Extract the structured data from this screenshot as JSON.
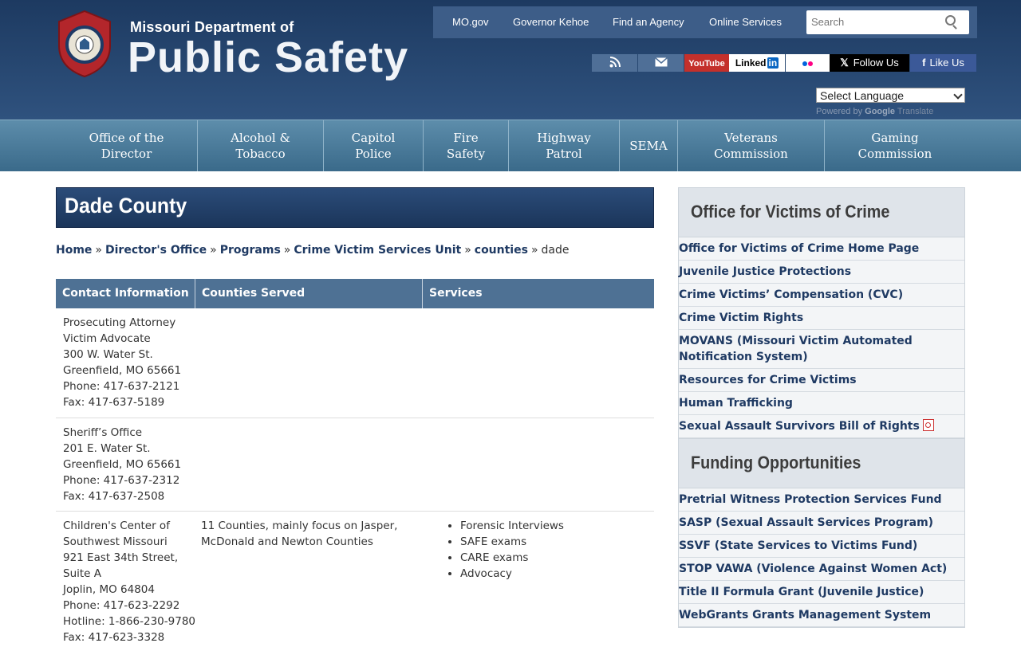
{
  "header": {
    "logo_line1": "Missouri Department of",
    "logo_line2": "Public Safety",
    "seal_text": "MISSOURI DEPARTMENT OF PUBLIC SAFETY",
    "top_links": [
      "MO.gov",
      "Governor Kehoe",
      "Find an Agency",
      "Online Services"
    ],
    "search_placeholder": "Search",
    "social": {
      "youtube": "YouTube",
      "linkedin": "Linked",
      "linkedin_in": "in",
      "x_follow": "Follow Us",
      "facebook_like": "Like Us"
    },
    "language_select": "Select Language",
    "powered_by": "Powered by",
    "google": "Google",
    "translate": "Translate"
  },
  "nav": [
    {
      "line1": "Office of the",
      "line2": "Director"
    },
    {
      "line1": "Alcohol &",
      "line2": "Tobacco"
    },
    {
      "line1": "Capitol",
      "line2": "Police"
    },
    {
      "line1": "Fire",
      "line2": "Safety"
    },
    {
      "line1": "Highway",
      "line2": "Patrol"
    },
    {
      "line1": "SEMA",
      "line2": ""
    },
    {
      "line1": "Veterans",
      "line2": "Commission"
    },
    {
      "line1": "Gaming",
      "line2": "Commission"
    }
  ],
  "page_title": "Dade County",
  "breadcrumb": {
    "items": [
      "Home",
      "Director's Office",
      "Programs",
      "Crime Victim Services Unit",
      "counties"
    ],
    "current": "dade",
    "separator": "»"
  },
  "table": {
    "headers": [
      "Contact Information",
      "Counties Served",
      "Services"
    ],
    "rows": [
      {
        "contact": [
          "Prosecuting Attorney",
          "Victim Advocate",
          "300 W. Water St.",
          "Greenfield, MO 65661",
          "Phone: 417-637-2121",
          "Fax: 417-637-5189"
        ],
        "counties": "",
        "services": []
      },
      {
        "contact": [
          "Sheriff’s Office",
          "201 E. Water St.",
          "Greenfield, MO 65661",
          "Phone: 417-637-2312",
          "Fax: 417-637-2508"
        ],
        "counties": "",
        "services": []
      },
      {
        "contact": [
          "Children's Center of",
          "Southwest Missouri",
          "921 East 34th Street,",
          "Suite A",
          "Joplin, MO 64804",
          "Phone: 417-623-2292",
          "Hotline: 1-866-230-9780",
          "Fax: 417-623-3328"
        ],
        "counties": [
          "11 Counties, mainly focus on Jasper,",
          "McDonald and Newton Counties"
        ],
        "services": [
          "Forensic Interviews",
          "SAFE exams",
          "CARE exams",
          "Advocacy"
        ]
      }
    ]
  },
  "sidebar": {
    "sections": [
      {
        "title": "Office for Victims of Crime",
        "links": [
          "Office for Victims of Crime Home Page",
          "Juvenile Justice Protections",
          "Crime Victims’ Compensation (CVC)",
          "Crime Victim Rights",
          "MOVANS (Missouri Victim Automated Notification System)",
          "Resources for Crime Victims",
          "Human Trafficking",
          "Sexual Assault Survivors Bill of Rights"
        ]
      },
      {
        "title": "Funding Opportunities",
        "links": [
          "Pretrial Witness Protection Services Fund",
          "SASP (Sexual Assault Services Program)",
          "SSVF (State Services to Victims Fund)",
          "STOP VAWA (Violence Against Women Act)",
          "Title II Formula Grant (Juvenile Justice)",
          "WebGrants Grants Management System"
        ]
      }
    ]
  },
  "colors": {
    "header_dark": "#1d3a61",
    "nav_blue": "#4a7a99",
    "link_navy": "#1f3a63",
    "table_header": "#4e7194"
  }
}
